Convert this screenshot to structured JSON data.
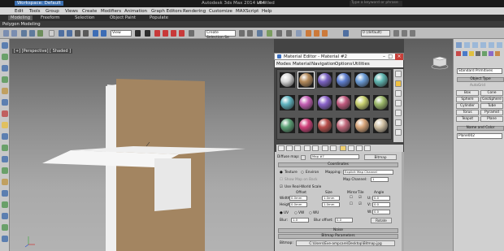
{
  "app": {
    "title": "Autodesk 3ds Max  2014 x64",
    "doc": "Untitled",
    "workspace": "Workspace: Default",
    "search_placeholder": "Type a keyword or phrase"
  },
  "menu": [
    "Edit",
    "Tools",
    "Group",
    "Views",
    "Create",
    "Modifiers",
    "Animation",
    "Graph Editors",
    "Rendering",
    "Customize",
    "MAXScript",
    "Help"
  ],
  "ribbon_tabs": [
    "Modeling",
    "Freeform",
    "Selection",
    "Object Paint",
    "Populate"
  ],
  "ribbon_sub": "Polygon Modeling",
  "toolbar": {
    "filter": "View",
    "selection_set": "Create Selection Se",
    "layer": "0 (default)"
  },
  "viewport": {
    "label": "[+] [Perspective] [ Shaded ]"
  },
  "material_editor": {
    "title": "Material Editor - Material #2",
    "menu": [
      "Modes",
      "Material",
      "Navigation",
      "Options",
      "Utilities"
    ],
    "slot_colors": [
      "#d8d8d8",
      "#b48a5a",
      "#7a62c2",
      "#5f7fcf",
      "#6a9bd6",
      "#5fb5b0",
      "#5fb3bf",
      "#c45fb4",
      "#8b63c9",
      "#c05a7e",
      "#c8d070",
      "#9cb86a",
      "#5da277",
      "#d0407a",
      "#b8504c",
      "#c26a7d",
      "#d8a57a",
      "#d0c0a4"
    ],
    "diffuse_label": "Diffuse map:",
    "map_name": "Map #7",
    "map_type": "Bitmap",
    "coords_header": "Coordinates",
    "texture_label": "Texture",
    "environ_label": "Environ",
    "mapping_label": "Mapping:",
    "mapping_value": "Explicit Map Channel",
    "show_map_label": "Show Map on Back",
    "map_channel_label": "Map Channel:",
    "map_channel_value": "1",
    "real_world_label": "Use Real-World Scale",
    "offset_label": "Offset",
    "size_label": "Size",
    "mirror_label": "Mirror",
    "tile_label": "Tile",
    "angle_label": "Angle",
    "width_label": "Width:",
    "height_label": "Height:",
    "u_label": "U:",
    "v_label": "V:",
    "w_label": "W:",
    "width_offset": "0.0mm",
    "height_offset": "0.0mm",
    "width_size": "1.0mm",
    "height_size": "1.0mm",
    "angle_u": "0.0",
    "angle_v": "0.0",
    "angle_w": "0.0",
    "uv": "UV",
    "vw": "VW",
    "wu": "WU",
    "blur_label": "Blur:",
    "blur_value": "1.0",
    "blur_offset_label": "Blur offset:",
    "blur_offset_value": "0.0",
    "rotate_label": "Rotate",
    "noise_header": "Noise",
    "bitmap_params_header": "Bitmap Parameters",
    "bitmap_label": "Bitmap:",
    "bitmap_path": "C:\\Users\\Eve-ampcare\\Desktop\\Bitmap.jpg"
  },
  "command_panel": {
    "dropdown": "Standard Primitives",
    "object_type_header": "Object Type",
    "autogrid": "AutoGrid",
    "buttons": [
      "Box",
      "Cone",
      "Sphere",
      "GeoSphere",
      "Cylinder",
      "Tube",
      "Torus",
      "Pyramid",
      "Teapot",
      "Plane"
    ],
    "name_color_header": "Name and Color",
    "object_name": "Plane002"
  }
}
